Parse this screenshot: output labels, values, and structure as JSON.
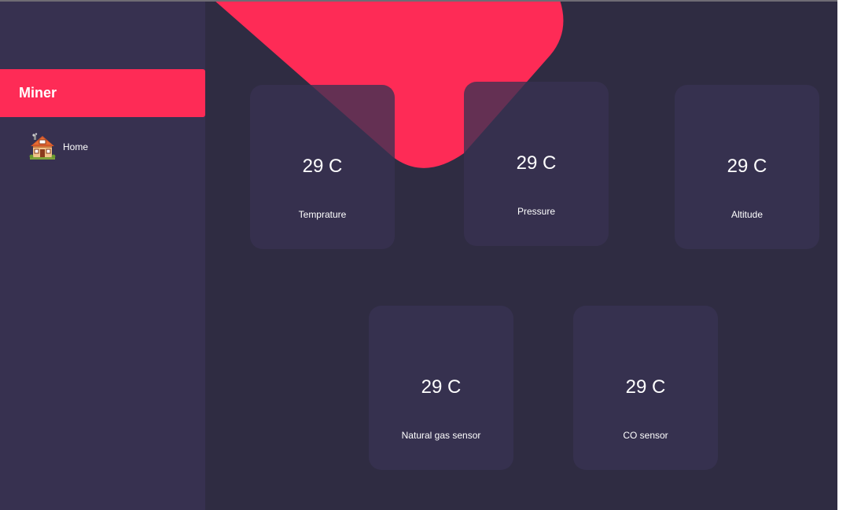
{
  "app": {
    "brand_title": "Miner"
  },
  "sidebar": {
    "items": [
      {
        "label": "Home",
        "icon": "house-icon"
      }
    ]
  },
  "colors": {
    "accent": "#fe2b56",
    "sidebar_bg": "#373150",
    "content_bg": "#2f2c42",
    "card_bg": "#36314f",
    "text": "#ffffff"
  },
  "cards": {
    "temperature": {
      "value": "29 C",
      "label": "Temprature"
    },
    "pressure": {
      "value": "29 C",
      "label": "Pressure"
    },
    "altitude": {
      "value": "29 C",
      "label": "Altitude"
    },
    "natural_gas": {
      "value": "29 C",
      "label": "Natural gas sensor"
    },
    "co": {
      "value": "29 C",
      "label": "CO sensor"
    }
  }
}
